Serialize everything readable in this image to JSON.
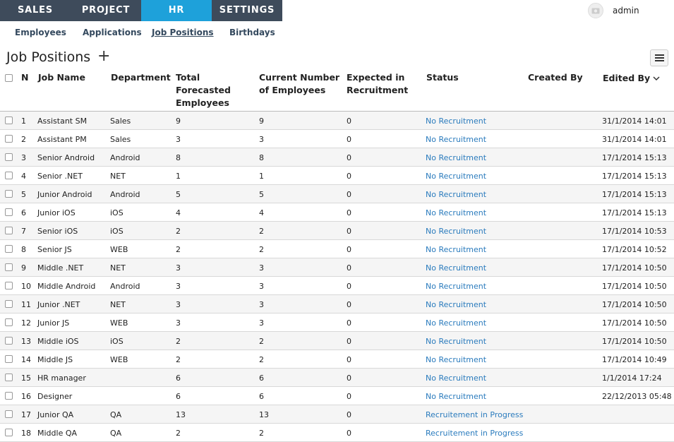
{
  "nav": {
    "tabs": [
      {
        "label": "SALES"
      },
      {
        "label": "PROJECT"
      },
      {
        "label": "HR"
      },
      {
        "label": "SETTINGS"
      }
    ],
    "active_tab": "HR",
    "username": "admin"
  },
  "subnav": {
    "items": [
      {
        "label": "Employees"
      },
      {
        "label": "Applications"
      },
      {
        "label": "Job Positions"
      },
      {
        "label": "Birthdays"
      }
    ],
    "active": "Job Positions"
  },
  "page": {
    "title": "Job Positions",
    "add_symbol": "+"
  },
  "table": {
    "columns": {
      "n": "N",
      "job_name": "Job Name",
      "department": "Department",
      "total": [
        "Total",
        "Forecasted",
        "Employees"
      ],
      "current": [
        "Current Number",
        "of Employees"
      ],
      "expected": [
        "Expected in",
        "Recruitment"
      ],
      "status": "Status",
      "created_by": "Created By",
      "edited_by": "Edited By"
    },
    "rows": [
      {
        "n": "1",
        "name": "Assistant SM",
        "dept": "Sales",
        "total": "9",
        "current": "9",
        "expected": "0",
        "status": "No Recruitment",
        "created": "",
        "edited": "31/1/2014 14:01"
      },
      {
        "n": "2",
        "name": "Assistant PM",
        "dept": "Sales",
        "total": "3",
        "current": "3",
        "expected": "0",
        "status": "No Recruitment",
        "created": "",
        "edited": "31/1/2014 14:01"
      },
      {
        "n": "3",
        "name": "Senior Android",
        "dept": "Android",
        "total": "8",
        "current": "8",
        "expected": "0",
        "status": "No Recruitment",
        "created": "",
        "edited": "17/1/2014 15:13"
      },
      {
        "n": "4",
        "name": "Senior .NET",
        "dept": "NET",
        "total": "1",
        "current": "1",
        "expected": "0",
        "status": "No Recruitment",
        "created": "",
        "edited": "17/1/2014 15:13"
      },
      {
        "n": "5",
        "name": "Junior Android",
        "dept": "Android",
        "total": "5",
        "current": "5",
        "expected": "0",
        "status": "No Recruitment",
        "created": "",
        "edited": "17/1/2014 15:13"
      },
      {
        "n": "6",
        "name": "Junior iOS",
        "dept": "iOS",
        "total": "4",
        "current": "4",
        "expected": "0",
        "status": "No Recruitment",
        "created": "",
        "edited": "17/1/2014 15:13"
      },
      {
        "n": "7",
        "name": "Senior iOS",
        "dept": "iOS",
        "total": "2",
        "current": "2",
        "expected": "0",
        "status": "No Recruitment",
        "created": "",
        "edited": "17/1/2014 10:53"
      },
      {
        "n": "8",
        "name": "Senior JS",
        "dept": "WEB",
        "total": "2",
        "current": "2",
        "expected": "0",
        "status": "No Recruitment",
        "created": "",
        "edited": "17/1/2014 10:52"
      },
      {
        "n": "9",
        "name": "Middle .NET",
        "dept": "NET",
        "total": "3",
        "current": "3",
        "expected": "0",
        "status": "No Recruitment",
        "created": "",
        "edited": "17/1/2014 10:50"
      },
      {
        "n": "10",
        "name": "Middle Android",
        "dept": "Android",
        "total": "3",
        "current": "3",
        "expected": "0",
        "status": "No Recruitment",
        "created": "",
        "edited": "17/1/2014 10:50"
      },
      {
        "n": "11",
        "name": "Junior .NET",
        "dept": "NET",
        "total": "3",
        "current": "3",
        "expected": "0",
        "status": "No Recruitment",
        "created": "",
        "edited": "17/1/2014 10:50"
      },
      {
        "n": "12",
        "name": "Junior JS",
        "dept": "WEB",
        "total": "3",
        "current": "3",
        "expected": "0",
        "status": "No Recruitment",
        "created": "",
        "edited": "17/1/2014 10:50"
      },
      {
        "n": "13",
        "name": "Middle iOS",
        "dept": "iOS",
        "total": "2",
        "current": "2",
        "expected": "0",
        "status": "No Recruitment",
        "created": "",
        "edited": "17/1/2014 10:50"
      },
      {
        "n": "14",
        "name": "Middle JS",
        "dept": "WEB",
        "total": "2",
        "current": "2",
        "expected": "0",
        "status": "No Recruitment",
        "created": "",
        "edited": "17/1/2014 10:49"
      },
      {
        "n": "15",
        "name": "HR manager",
        "dept": "",
        "total": "6",
        "current": "6",
        "expected": "0",
        "status": "No Recruitment",
        "created": "",
        "edited": "1/1/2014 17:24"
      },
      {
        "n": "16",
        "name": "Designer",
        "dept": "",
        "total": "6",
        "current": "6",
        "expected": "0",
        "status": "No Recruitment",
        "created": "",
        "edited": "22/12/2013 05:48"
      },
      {
        "n": "17",
        "name": "Junior QA",
        "dept": "QA",
        "total": "13",
        "current": "13",
        "expected": "0",
        "status": "Recruitement in Progress",
        "created": "",
        "edited": ""
      },
      {
        "n": "18",
        "name": "Middle QA",
        "dept": "QA",
        "total": "2",
        "current": "2",
        "expected": "0",
        "status": "Recruitement in Progress",
        "created": "",
        "edited": ""
      }
    ]
  },
  "icons": {
    "avatar": "user-avatar-icon",
    "menu": "hamburger-menu-icon",
    "sort": "chevron-down-icon",
    "add": "plus-icon"
  },
  "colors": {
    "nav_bg": "#3e4b5b",
    "nav_active": "#1ea1da",
    "status_link": "#2a7bbd"
  }
}
